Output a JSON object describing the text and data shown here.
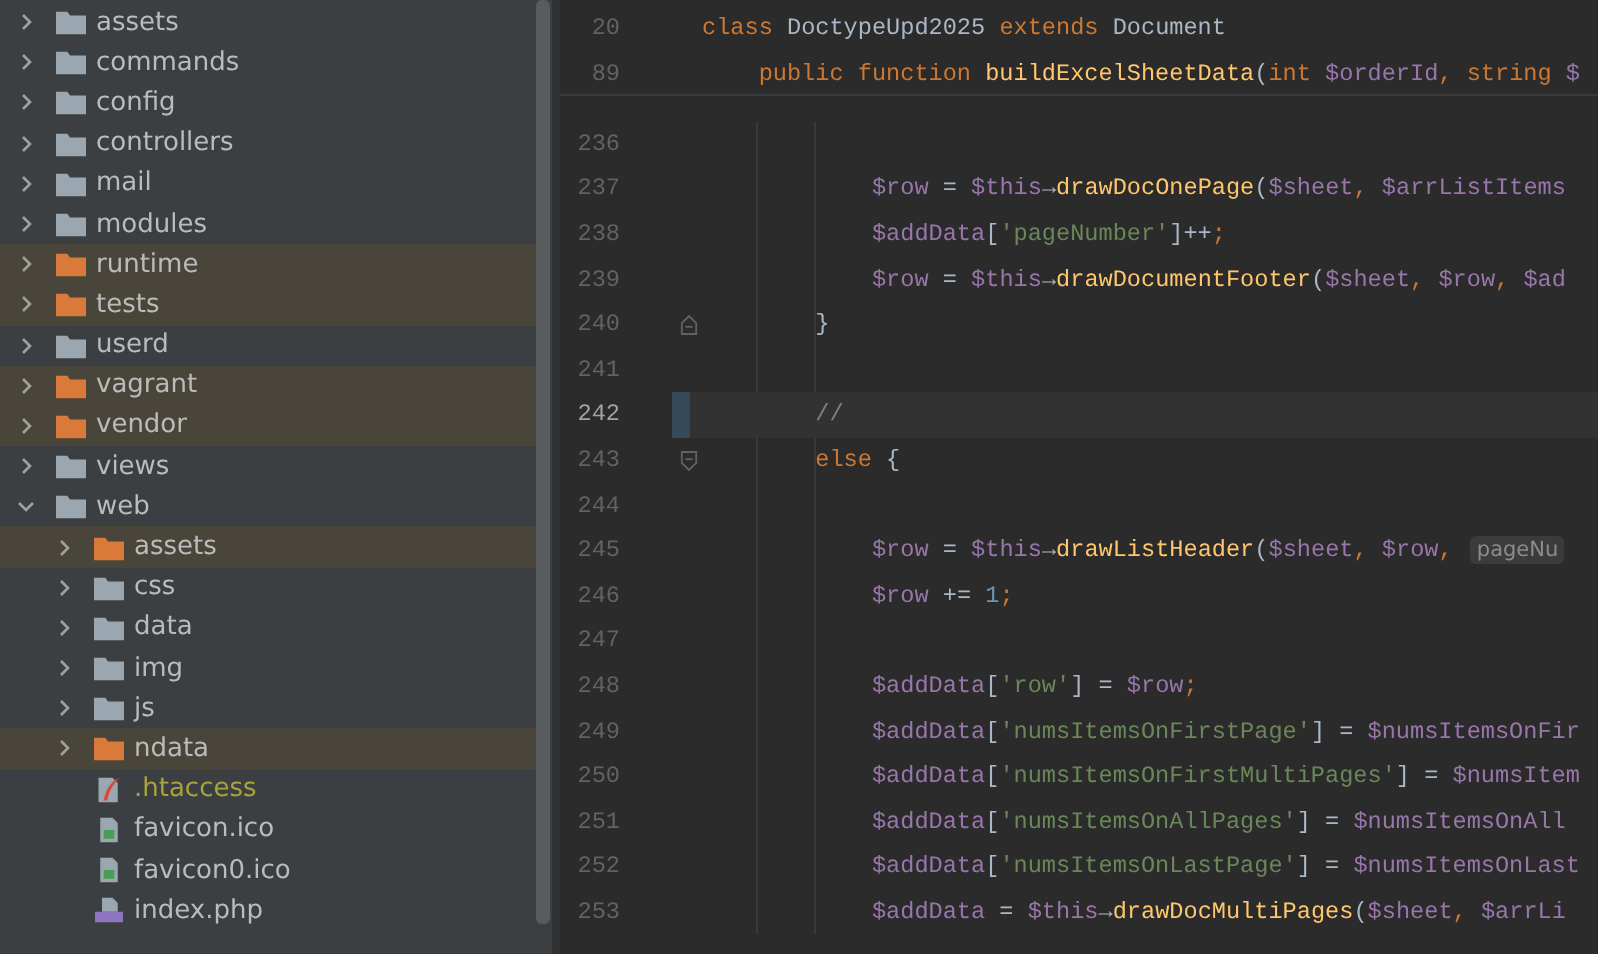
{
  "project_tree": {
    "items": [
      {
        "name": "assets",
        "kind": "folder",
        "expanded": false,
        "excluded": false
      },
      {
        "name": "commands",
        "kind": "folder",
        "expanded": false,
        "excluded": false
      },
      {
        "name": "config",
        "kind": "folder",
        "expanded": false,
        "excluded": false
      },
      {
        "name": "controllers",
        "kind": "folder",
        "expanded": false,
        "excluded": false
      },
      {
        "name": "mail",
        "kind": "folder",
        "expanded": false,
        "excluded": false
      },
      {
        "name": "modules",
        "kind": "folder",
        "expanded": false,
        "excluded": false
      },
      {
        "name": "runtime",
        "kind": "folder",
        "expanded": false,
        "excluded": true
      },
      {
        "name": "tests",
        "kind": "folder",
        "expanded": false,
        "excluded": true
      },
      {
        "name": "userd",
        "kind": "folder",
        "expanded": false,
        "excluded": false
      },
      {
        "name": "vagrant",
        "kind": "folder",
        "expanded": false,
        "excluded": true
      },
      {
        "name": "vendor",
        "kind": "folder",
        "expanded": false,
        "excluded": true
      },
      {
        "name": "views",
        "kind": "folder",
        "expanded": false,
        "excluded": false
      },
      {
        "name": "web",
        "kind": "folder",
        "expanded": true,
        "excluded": false,
        "children": [
          {
            "name": "assets",
            "kind": "folder",
            "expanded": false,
            "excluded": true
          },
          {
            "name": "css",
            "kind": "folder",
            "expanded": false,
            "excluded": false
          },
          {
            "name": "data",
            "kind": "folder",
            "expanded": false,
            "excluded": false
          },
          {
            "name": "img",
            "kind": "folder",
            "expanded": false,
            "excluded": false
          },
          {
            "name": "js",
            "kind": "folder",
            "expanded": false,
            "excluded": false
          },
          {
            "name": "ndata",
            "kind": "folder",
            "expanded": false,
            "excluded": true
          },
          {
            "name": ".htaccess",
            "kind": "config-file",
            "ignored": true
          },
          {
            "name": "favicon.ico",
            "kind": "image-file",
            "ignored": false
          },
          {
            "name": "favicon0.ico",
            "kind": "image-file",
            "ignored": false
          },
          {
            "name": "index.php",
            "kind": "php-file",
            "ignored": false
          }
        ]
      }
    ]
  },
  "editor": {
    "sticky_lines": [
      {
        "number": "20",
        "tokens": [
          {
            "kind": "kw",
            "text": "class "
          },
          {
            "kind": "plain",
            "text": "DoctypeUpd2025 "
          },
          {
            "kind": "kw",
            "text": "extends "
          },
          {
            "kind": "plain",
            "text": "Document"
          }
        ]
      },
      {
        "number": "89",
        "tokens": [
          {
            "kind": "kw",
            "text": "    public function "
          },
          {
            "kind": "fn",
            "text": "buildExcelSheetData"
          },
          {
            "kind": "plain",
            "text": "("
          },
          {
            "kind": "kw",
            "text": "int "
          },
          {
            "kind": "var",
            "text": "$orderId"
          },
          {
            "kind": "kw",
            "text": ", string "
          },
          {
            "kind": "var",
            "text": "$"
          }
        ]
      }
    ],
    "lines": [
      {
        "number": "236",
        "current": false,
        "kind": "code"
      },
      {
        "number": "237",
        "current": false,
        "tokens": [
          {
            "kind": "var",
            "text": "            $row"
          },
          {
            "kind": "plain",
            "text": " = "
          },
          {
            "kind": "var",
            "text": "$this"
          },
          {
            "kind": "plain",
            "text": "→"
          },
          {
            "kind": "fn",
            "text": "drawDocOnePage"
          },
          {
            "kind": "plain",
            "text": "("
          },
          {
            "kind": "var",
            "text": "$sheet"
          },
          {
            "kind": "kw",
            "text": ", "
          },
          {
            "kind": "var",
            "text": "$arrListItems"
          }
        ]
      },
      {
        "number": "238",
        "current": false,
        "tokens": [
          {
            "kind": "var",
            "text": "            $addData"
          },
          {
            "kind": "plain",
            "text": "["
          },
          {
            "kind": "str",
            "text": "'pageNumber'"
          },
          {
            "kind": "plain",
            "text": "]++"
          },
          {
            "kind": "kw",
            "text": ";"
          }
        ]
      },
      {
        "number": "239",
        "current": false,
        "tokens": [
          {
            "kind": "var",
            "text": "            $row"
          },
          {
            "kind": "plain",
            "text": " = "
          },
          {
            "kind": "var",
            "text": "$this"
          },
          {
            "kind": "plain",
            "text": "→"
          },
          {
            "kind": "fn",
            "text": "drawDocumentFooter"
          },
          {
            "kind": "plain",
            "text": "("
          },
          {
            "kind": "var",
            "text": "$sheet"
          },
          {
            "kind": "kw",
            "text": ", "
          },
          {
            "kind": "var",
            "text": "$row"
          },
          {
            "kind": "kw",
            "text": ", "
          },
          {
            "kind": "var",
            "text": "$ad"
          }
        ]
      },
      {
        "number": "240",
        "current": false,
        "kind": "fold-end",
        "tokens": [
          {
            "kind": "plain",
            "text": "        }"
          }
        ]
      },
      {
        "number": "241",
        "current": false,
        "kind": "code"
      },
      {
        "number": "242",
        "current": true,
        "tokens": [
          {
            "kind": "comment",
            "text": "        //"
          }
        ]
      },
      {
        "number": "243",
        "current": false,
        "kind": "fold-start",
        "tokens": [
          {
            "kind": "kw",
            "text": "        else"
          },
          {
            "kind": "plain",
            "text": " {"
          }
        ]
      },
      {
        "number": "244",
        "current": false,
        "kind": "code"
      },
      {
        "number": "245",
        "current": false,
        "hint": "pageNu",
        "tokens": [
          {
            "kind": "var",
            "text": "            $row"
          },
          {
            "kind": "plain",
            "text": " = "
          },
          {
            "kind": "var",
            "text": "$this"
          },
          {
            "kind": "plain",
            "text": "→"
          },
          {
            "kind": "fn",
            "text": "drawListHeader"
          },
          {
            "kind": "plain",
            "text": "("
          },
          {
            "kind": "var",
            "text": "$sheet"
          },
          {
            "kind": "kw",
            "text": ", "
          },
          {
            "kind": "var",
            "text": "$row"
          },
          {
            "kind": "kw",
            "text": ", "
          }
        ]
      },
      {
        "number": "246",
        "current": false,
        "tokens": [
          {
            "kind": "var",
            "text": "            $row"
          },
          {
            "kind": "plain",
            "text": " += "
          },
          {
            "kind": "num",
            "text": "1"
          },
          {
            "kind": "kw",
            "text": ";"
          }
        ]
      },
      {
        "number": "247",
        "current": false,
        "kind": "code"
      },
      {
        "number": "248",
        "current": false,
        "tokens": [
          {
            "kind": "var",
            "text": "            $addData"
          },
          {
            "kind": "plain",
            "text": "["
          },
          {
            "kind": "str",
            "text": "'row'"
          },
          {
            "kind": "plain",
            "text": "] = "
          },
          {
            "kind": "var",
            "text": "$row"
          },
          {
            "kind": "kw",
            "text": ";"
          }
        ]
      },
      {
        "number": "249",
        "current": false,
        "tokens": [
          {
            "kind": "var",
            "text": "            $addData"
          },
          {
            "kind": "plain",
            "text": "["
          },
          {
            "kind": "str",
            "text": "'numsItemsOnFirstPage'"
          },
          {
            "kind": "plain",
            "text": "] = "
          },
          {
            "kind": "var",
            "text": "$numsItemsOnFir"
          }
        ]
      },
      {
        "number": "250",
        "current": false,
        "tokens": [
          {
            "kind": "var",
            "text": "            $addData"
          },
          {
            "kind": "plain",
            "text": "["
          },
          {
            "kind": "str",
            "text": "'numsItemsOnFirstMultiPages'"
          },
          {
            "kind": "plain",
            "text": "] = "
          },
          {
            "kind": "var",
            "text": "$numsItem"
          }
        ]
      },
      {
        "number": "251",
        "current": false,
        "tokens": [
          {
            "kind": "var",
            "text": "            $addData"
          },
          {
            "kind": "plain",
            "text": "["
          },
          {
            "kind": "str",
            "text": "'numsItemsOnAllPages'"
          },
          {
            "kind": "plain",
            "text": "] = "
          },
          {
            "kind": "var",
            "text": "$numsItemsOnAll"
          }
        ]
      },
      {
        "number": "252",
        "current": false,
        "tokens": [
          {
            "kind": "var",
            "text": "            $addData"
          },
          {
            "kind": "plain",
            "text": "["
          },
          {
            "kind": "str",
            "text": "'numsItemsOnLastPage'"
          },
          {
            "kind": "plain",
            "text": "] = "
          },
          {
            "kind": "var",
            "text": "$numsItemsOnLast"
          }
        ]
      },
      {
        "number": "253",
        "current": false,
        "tokens": [
          {
            "kind": "var",
            "text": "            $addData"
          },
          {
            "kind": "plain",
            "text": " = "
          },
          {
            "kind": "var",
            "text": "$this"
          },
          {
            "kind": "plain",
            "text": "→"
          },
          {
            "kind": "fn",
            "text": "drawDocMultiPages"
          },
          {
            "kind": "plain",
            "text": "("
          },
          {
            "kind": "var",
            "text": "$sheet"
          },
          {
            "kind": "kw",
            "text": ", "
          },
          {
            "kind": "var",
            "text": "$arrLi"
          }
        ]
      }
    ]
  }
}
